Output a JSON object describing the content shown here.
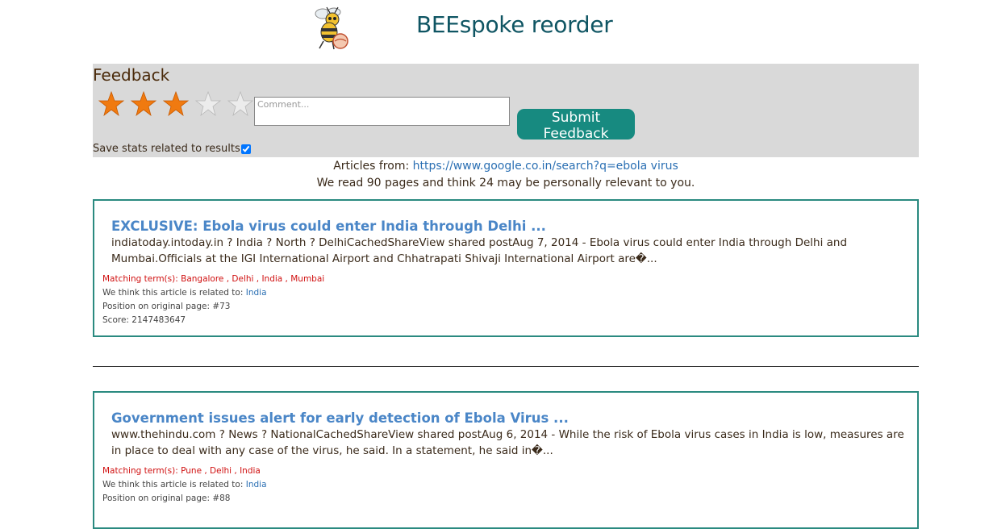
{
  "header": {
    "app_title": "BEEspoke reorder",
    "logo_icon": "bee-logo-icon"
  },
  "feedback": {
    "title": "Feedback",
    "rating": 3,
    "max_rating": 5,
    "comment_placeholder": "Comment...",
    "submit_label": "Submit Feedback",
    "save_stats_label": "Save stats related to results",
    "save_stats_checked": true
  },
  "source": {
    "prefix": "Articles from:",
    "url": "https://www.google.co.in/search?q=ebola virus"
  },
  "stats_text": "We read 90 pages and think 24 may be personally relevant to you.",
  "articles": [
    {
      "title": "EXCLUSIVE: Ebola virus could enter India through Delhi ...",
      "snippet": "indiatoday.intoday.in ? India ? North ? DelhiCachedShareView shared postAug 7, 2014 - Ebola virus could enter India through Delhi and Mumbai.Officials at the IGI International Airport and Chhatrapati Shivaji International Airport are�...",
      "matching_label": "Matching term(s):",
      "matching_terms": "Bangalore , Delhi , India , Mumbai",
      "related_label": "We think this article is related to:",
      "related": "India",
      "position_text": "Position on original page: #73",
      "score_text": "Score: 2147483647"
    },
    {
      "title": "Government issues alert for early detection of Ebola Virus ...",
      "snippet": "www.thehindu.com ? News ? NationalCachedShareView shared postAug 6, 2014 - While the risk of Ebola virus cases in India is low, measures are in place to deal with any case of the virus, he said. In a statement, he said in�...",
      "matching_label": "Matching term(s):",
      "matching_terms": "Pune , Delhi , India",
      "related_label": "We think this article is related to:",
      "related": "India",
      "position_text": "Position on original page: #88"
    }
  ],
  "colors": {
    "title_teal": "#0f5563",
    "panel_grey": "#d9d9d9",
    "button_teal": "#178a80",
    "star_orange": "#f07a10",
    "link_blue": "#4a86c7",
    "matching_red": "#d01010"
  }
}
